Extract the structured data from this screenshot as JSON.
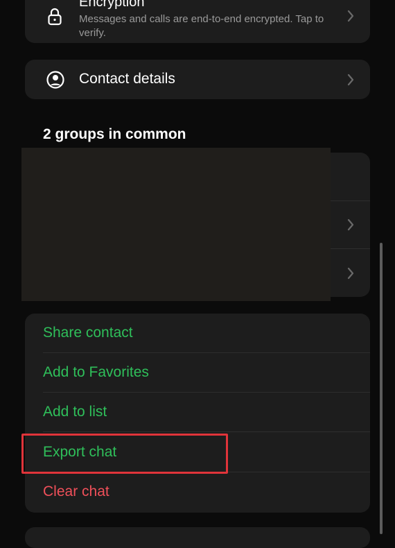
{
  "colors": {
    "background": "#0b0b0b",
    "card": "#1d1d1d",
    "accent_green": "#2fbf5a",
    "danger_red": "#f0505a",
    "highlight_red": "#e0343a",
    "subtitle_gray": "#9a9a9a"
  },
  "encryption": {
    "title": "Encryption",
    "subtitle": "Messages and calls are end-to-end encrypted. Tap to verify.",
    "icon": "lock-icon"
  },
  "contact_details": {
    "label": "Contact details",
    "icon": "person-circle-icon"
  },
  "groups": {
    "heading": "2 groups in common"
  },
  "actions": [
    {
      "label": "Share contact",
      "color": "#2fbf5a"
    },
    {
      "label": "Add to Favorites",
      "color": "#2fbf5a"
    },
    {
      "label": "Add to list",
      "color": "#2fbf5a"
    },
    {
      "label": "Export chat",
      "color": "#2fbf5a",
      "highlighted": true
    },
    {
      "label": "Clear chat",
      "color": "#f0505a"
    }
  ]
}
